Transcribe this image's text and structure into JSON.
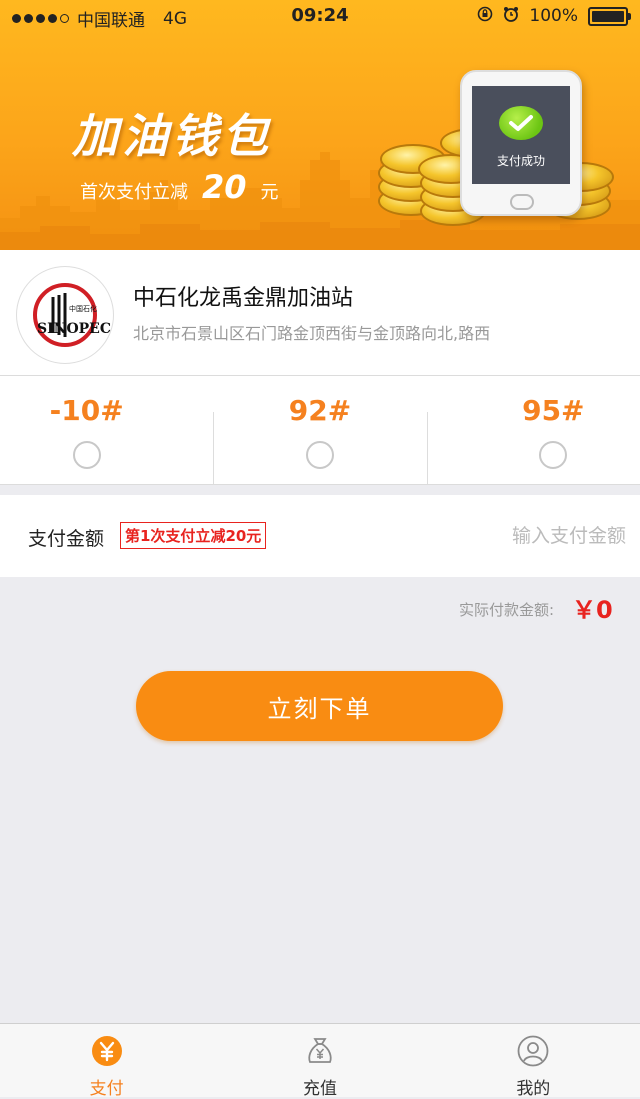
{
  "status_bar": {
    "carrier": "中国联通",
    "network": "4G",
    "time": "09:24",
    "battery": "100%"
  },
  "banner": {
    "title": "加油钱包",
    "subtitle_prefix": "首次支付立减",
    "subtitle_amount": "20",
    "subtitle_unit": "元",
    "phone_status": "支付成功"
  },
  "station": {
    "logo_text": "SINOPEC",
    "name": "中石化龙禹金鼎加油站",
    "address": "北京市石景山区石门路金顶西街与金顶路向北,路西"
  },
  "fuel_options": [
    {
      "label": "-10#",
      "selected": false
    },
    {
      "label": "92#",
      "selected": false
    },
    {
      "label": "95#",
      "selected": false
    }
  ],
  "payment": {
    "label": "支付金额",
    "promo": "第1次支付立减20元",
    "input_placeholder": "输入支付金额",
    "actual_label": "实际付款金额:",
    "actual_value": "￥0"
  },
  "order_button": "立刻下单",
  "tabs": [
    {
      "label": "支付",
      "icon": "yuan-coin-icon",
      "active": true
    },
    {
      "label": "充值",
      "icon": "money-bag-icon",
      "active": false
    },
    {
      "label": "我的",
      "icon": "user-profile-icon",
      "active": false
    }
  ],
  "colors": {
    "accent": "#f98c12",
    "fuel_label": "#f5811f",
    "price_red": "#e8231f"
  }
}
